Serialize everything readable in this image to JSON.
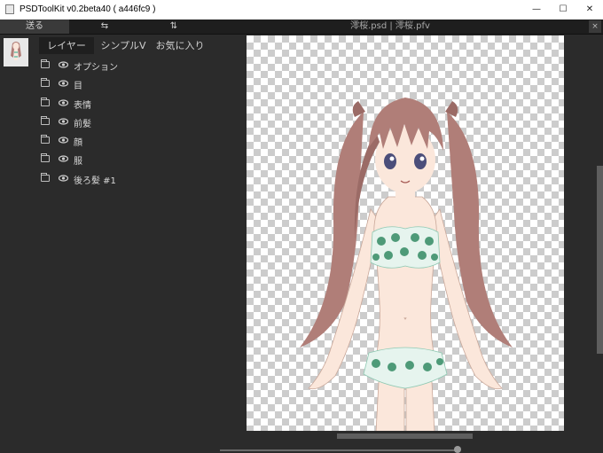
{
  "window": {
    "title": "PSDToolKit v0.2beta40 ( a446fc9 )",
    "controls": {
      "minimize": "—",
      "maximize": "☐",
      "close": "✕"
    }
  },
  "toolbar": {
    "send_label": "送る",
    "flip_h_icon": "⇆",
    "flip_v_icon": "⇅",
    "file_info": "澪桜.psd | 澪桜.pfv",
    "close_panel": "×"
  },
  "sidebar": {
    "tabs": [
      {
        "label": "レイヤー",
        "active": true
      },
      {
        "label": "シンプルV",
        "active": false
      },
      {
        "label": "お気に入り",
        "active": false
      }
    ],
    "layers": [
      {
        "name": "オプション"
      },
      {
        "name": "目"
      },
      {
        "name": "表情"
      },
      {
        "name": "前髪"
      },
      {
        "name": "顔"
      },
      {
        "name": "服"
      },
      {
        "name": "後ろ髪 #1"
      }
    ]
  },
  "colors": {
    "background": "#2b2b2b",
    "titlebar": "#ffffff",
    "hair": "#b07e78",
    "skin": "#fbe7db",
    "swimsuit_dots": "#4e9a78"
  }
}
